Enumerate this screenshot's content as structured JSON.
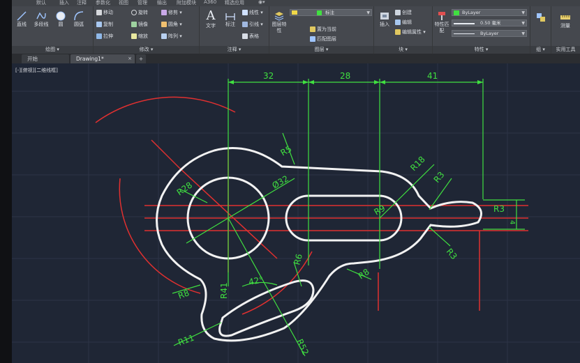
{
  "menu": {
    "tabs": [
      "默认",
      "插入",
      "注释",
      "参数化",
      "视图",
      "管理",
      "输出",
      "附加模块",
      "A360",
      "精选应用",
      "◉▾"
    ]
  },
  "ribbon": {
    "draw": {
      "title": "绘图 ▾",
      "line": "直线",
      "polyline": "多段线",
      "circle": "圆",
      "arc": "圆弧"
    },
    "modify": {
      "title": "修改 ▾",
      "move": "移动",
      "rotate": "旋转",
      "trim": "修剪 ▾",
      "copy": "复制",
      "mirror": "镜像",
      "fillet": "圆角 ▾",
      "stretch": "拉伸",
      "scale": "缩放",
      "array": "阵列 ▾"
    },
    "annotation": {
      "title": "注释 ▾",
      "text": "文字",
      "dimension": "标注",
      "linear": "线性 ▾",
      "leader": "引线 ▾",
      "table": "表格"
    },
    "layers": {
      "title": "图层 ▾",
      "layer_props": "图层特性",
      "current_layer": "标注",
      "set_current": "置为当前",
      "match_layer": "匹配图层"
    },
    "block": {
      "title": "块 ▾",
      "insert": "插入",
      "create": "创建",
      "edit": "编辑",
      "edit_attr": "编辑属性 ▾"
    },
    "properties": {
      "title": "特性 ▾",
      "match": "特性匹配",
      "color": "ByLayer",
      "lineweight": "0.50 毫米",
      "linetype": "ByLayer"
    },
    "groups": {
      "title": "组 ▾"
    },
    "utilities": {
      "title": "实用工具",
      "measure": "测量"
    }
  },
  "tabs": {
    "start": "开始",
    "drawing": "Drawing1*",
    "add": "+"
  },
  "viewport": {
    "label": "[-][俯视][二维线框]"
  },
  "dimensions": {
    "d32": "32",
    "d28": "28",
    "d41": "41",
    "r5": "R5",
    "r28": "R28",
    "dia32": "Ø32",
    "r18": "R18",
    "r3a": "R3",
    "r3b": "R3",
    "r3c": "R3",
    "r9": "R9",
    "d4": "4",
    "r8a": "R8",
    "r8b": "R8",
    "r6": "R6",
    "a42": "42°",
    "r41": "R41",
    "r11": "R11",
    "r52": "R52"
  },
  "colors": {
    "outline": "#f2f2f2",
    "dimension": "#40e040",
    "centerline": "#e03030",
    "background": "#1f2635",
    "ribbon": "#45484e"
  }
}
